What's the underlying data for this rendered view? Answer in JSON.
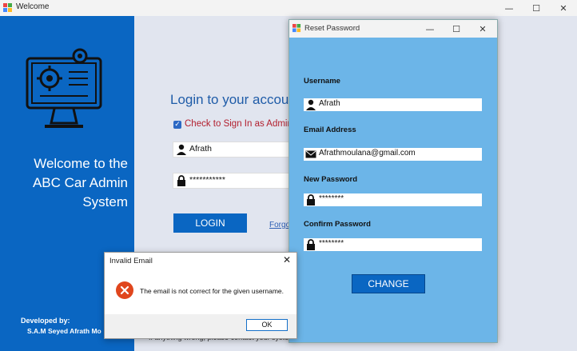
{
  "main_window": {
    "title": "Welcome",
    "controls": {
      "minimize": "—",
      "maximize": "☐",
      "close": "✕"
    }
  },
  "left_panel": {
    "welcome_text": "Welcome to the ABC Car Admin System",
    "developed_by_label": "Developed by:",
    "developer_name": "S.A.M Seyed Afrath Mo"
  },
  "login": {
    "title": "Login to your accou",
    "admin_check_label": "Check to Sign In as Admin",
    "username_value": "Afrath",
    "password_value": "***********",
    "login_button": "LOGIN",
    "forgot_link": "Forgo",
    "contact_text": "If anything wrong, please contact your syste"
  },
  "reset_window": {
    "title": "Reset Password",
    "username_label": "Username",
    "username_value": "Afrath",
    "email_label": "Email Address",
    "email_value": "Afrathmoulana@gmail.com",
    "new_password_label": "New Password",
    "new_password_value": "********",
    "confirm_password_label": "Confirm Password",
    "confirm_password_value": "********",
    "change_button": "CHANGE"
  },
  "dialog": {
    "title": "Invalid Email",
    "message": "The email is not correct for the given username.",
    "ok_button": "OK"
  },
  "colors": {
    "panel_blue": "#0a66c2",
    "reset_bg": "#6cb5e8",
    "error_red": "#e0461d"
  }
}
